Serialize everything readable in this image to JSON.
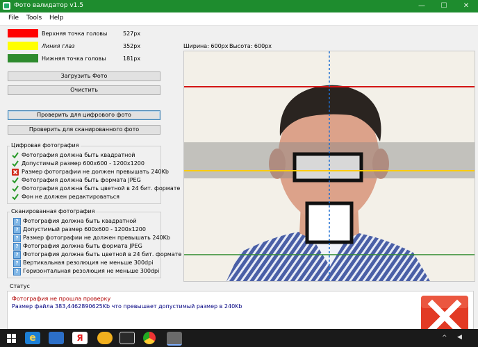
{
  "window": {
    "title": "Фото валидатор v1.5"
  },
  "window_controls": {
    "minimize": "—",
    "maximize": "☐",
    "close": "✕"
  },
  "menu": [
    "File",
    "Tools",
    "Help"
  ],
  "legend": [
    {
      "label": "Верхняя точка головы",
      "value": "527px",
      "color": "#ff0000"
    },
    {
      "label": "Линия глаз",
      "value": "352px",
      "color": "#ffff00"
    },
    {
      "label": "Нижняя точка головы",
      "value": "181px",
      "color": "#2e8b2e"
    }
  ],
  "buttons": {
    "load": "Загрузить Фото",
    "clear": "Очистить",
    "check_digital": "Проверить для цифрового фото",
    "check_scanned": "Проверить для сканированного фото"
  },
  "digital_group": {
    "title": "Цифровая фотография",
    "items": [
      {
        "text": "Фотография должна быть квадратной",
        "status": "ok"
      },
      {
        "text": "Допустимый размер 600x600 - 1200x1200",
        "status": "ok"
      },
      {
        "text": "Размер фотографии не должен превышать 240Kb",
        "status": "error"
      },
      {
        "text": "Фотография должна быть формата JPEG",
        "status": "ok"
      },
      {
        "text": "Фотография должна быть цветной в 24 бит. формате",
        "status": "ok"
      },
      {
        "text": "Фон не должен редактироваться",
        "status": "ok"
      }
    ]
  },
  "scanned_group": {
    "title": "Сканированная фотография",
    "items": [
      {
        "text": "Фотография должна быть квадратной",
        "status": "unknown"
      },
      {
        "text": "Допустимый размер 600x600 - 1200x1200",
        "status": "unknown"
      },
      {
        "text": "Размер фотографии не должен превышать 240Kb",
        "status": "unknown"
      },
      {
        "text": "Фотография должна быть формата JPEG",
        "status": "unknown"
      },
      {
        "text": "Фотография должна быть цветной в 24 бит. формате",
        "status": "unknown"
      },
      {
        "text": "Вертикальная резолюция не меньше 300dpi",
        "status": "unknown"
      },
      {
        "text": "Горизонтальная резолюция не меньше 300dpi",
        "status": "unknown"
      }
    ]
  },
  "photo": {
    "width_label": "Ширина: 600px",
    "height_label": "Высота: 600px"
  },
  "status": {
    "title": "Статус",
    "line1": "Фотография не прошла проверку",
    "line2": "Размер файла 383,4462890625Kb что превышает допустимый размер в 240Kb",
    "line1_color": "#b00000",
    "line2_color": "#000080"
  },
  "taskbar_icons": [
    "windows-icon",
    "ie-icon",
    "speaker-icon",
    "yandex-icon",
    "app-icon",
    "mail-icon",
    "chrome-icon",
    "camera-icon"
  ],
  "tray": {
    "chevron": "^",
    "lang": "◀"
  }
}
